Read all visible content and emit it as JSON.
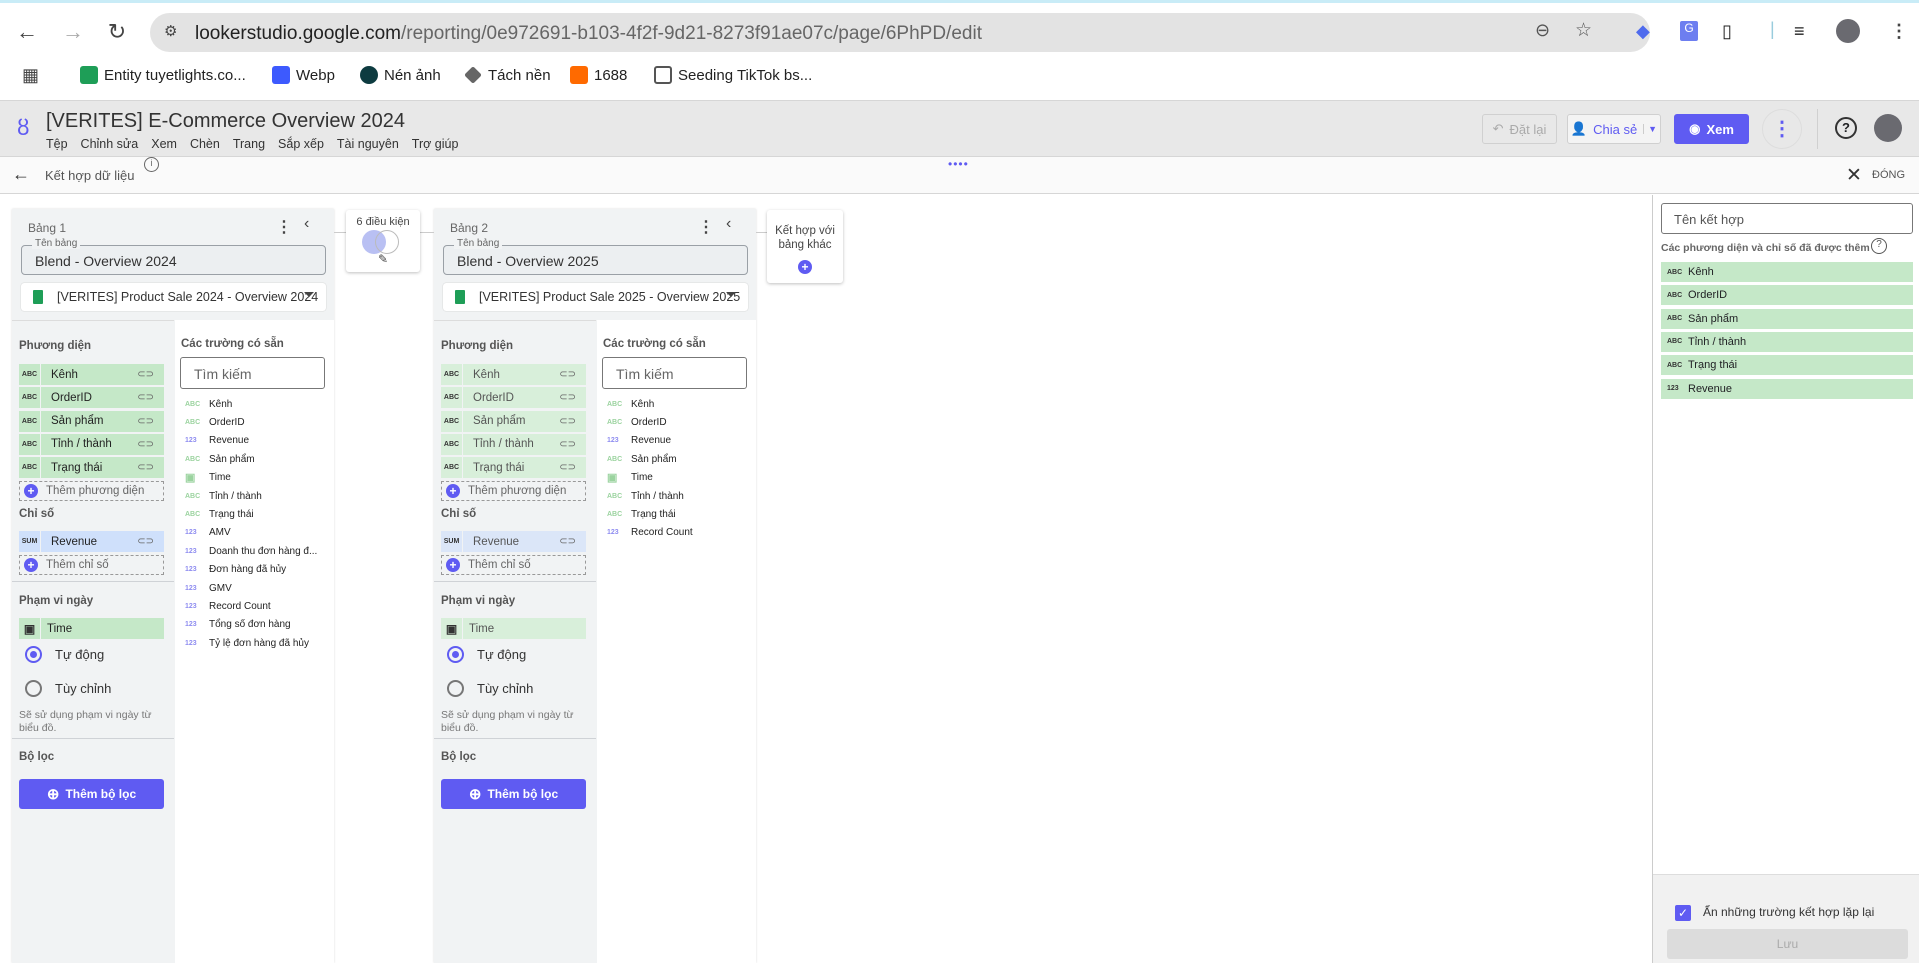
{
  "browser": {
    "url_host": "lookerstudio.google.com",
    "url_path": "/reporting/0e972691-b103-4f2f-9d21-8273f91ae07c/page/6PhPD/edit",
    "bookmarks": [
      {
        "label": "Entity tuyetlights.co...",
        "icon": "sheets-plus-icon",
        "color": "#1e9e57"
      },
      {
        "label": "Webp",
        "icon": "power-icon",
        "color": "#3d5afe"
      },
      {
        "label": "Nén ảnh",
        "icon": "dot-icon",
        "color": "#0d3b40"
      },
      {
        "label": "Tách nền",
        "icon": "layers-icon",
        "color": "#555555"
      },
      {
        "label": "1688",
        "icon": "1688-icon",
        "color": "#ff6a00"
      },
      {
        "label": "Seeding TikTok bs...",
        "icon": "folder-icon",
        "color": "#555555"
      }
    ]
  },
  "app": {
    "title": "[VERITES] E-Commerce Overview 2024",
    "menu": [
      "Tệp",
      "Chỉnh sửa",
      "Xem",
      "Chèn",
      "Trang",
      "Sắp xếp",
      "Tài nguyên",
      "Trợ giúp"
    ],
    "reset_label": "Đặt lại",
    "share_label": "Chia sẻ",
    "view_label": "Xem",
    "accent": "#5f5bf2"
  },
  "subheader": {
    "title": "Kết hợp dữ liệu",
    "close_label": "ĐÓNG"
  },
  "tables": [
    {
      "title": "Bảng 1",
      "name_label": "Tên bảng",
      "name": "Blend - Overview 2024",
      "source": "[VERITES] Product Sale 2024 - Overview 2024",
      "dimensions_label": "Phương diện",
      "dimensions": [
        {
          "type": "ABC",
          "name": "Kênh"
        },
        {
          "type": "ABC",
          "name": "OrderID"
        },
        {
          "type": "ABC",
          "name": "Sản phẩm"
        },
        {
          "type": "ABC",
          "name": "Tỉnh / thành"
        },
        {
          "type": "ABC",
          "name": "Trạng thái"
        }
      ],
      "add_dimension": "Thêm phương diện",
      "metrics_label": "Chỉ số",
      "metrics": [
        {
          "type": "SUM",
          "name": "Revenue"
        }
      ],
      "add_metric": "Thêm chỉ số",
      "date_range_label": "Phạm vi ngày",
      "date_field": "Time",
      "auto_label": "Tự động",
      "custom_label": "Tùy chỉnh",
      "date_note": "Sẽ sử dụng phạm vi ngày từ biểu đồ.",
      "filter_label": "Bộ lọc",
      "add_filter": "Thêm bộ lọc",
      "available_label": "Các trường có sẵn",
      "search_placeholder": "Tìm kiếm",
      "available": [
        {
          "type": "ABC",
          "name": "Kênh"
        },
        {
          "type": "ABC",
          "name": "OrderID"
        },
        {
          "type": "123",
          "name": "Revenue"
        },
        {
          "type": "ABC",
          "name": "Sản phẩm"
        },
        {
          "type": "date",
          "name": "Time"
        },
        {
          "type": "ABC",
          "name": "Tỉnh / thành"
        },
        {
          "type": "ABC",
          "name": "Trạng thái"
        },
        {
          "type": "123",
          "name": "AMV"
        },
        {
          "type": "123",
          "name": "Doanh thu đơn hàng đ..."
        },
        {
          "type": "123",
          "name": "Đơn hàng đã hủy"
        },
        {
          "type": "123",
          "name": "GMV"
        },
        {
          "type": "123",
          "name": "Record Count"
        },
        {
          "type": "123",
          "name": "Tổng số đơn hàng"
        },
        {
          "type": "123",
          "name": "Tỷ lệ đơn hàng đã hủy"
        }
      ]
    },
    {
      "title": "Bảng 2",
      "name_label": "Tên bảng",
      "name": "Blend - Overview 2025",
      "source": "[VERITES] Product Sale 2025 - Overview 2025",
      "dimensions_label": "Phương diện",
      "dimensions": [
        {
          "type": "ABC",
          "name": "Kênh"
        },
        {
          "type": "ABC",
          "name": "OrderID"
        },
        {
          "type": "ABC",
          "name": "Sản phẩm"
        },
        {
          "type": "ABC",
          "name": "Tỉnh / thành"
        },
        {
          "type": "ABC",
          "name": "Trạng thái"
        }
      ],
      "add_dimension": "Thêm phương diện",
      "metrics_label": "Chỉ số",
      "metrics": [
        {
          "type": "SUM",
          "name": "Revenue"
        }
      ],
      "add_metric": "Thêm chỉ số",
      "date_range_label": "Phạm vi ngày",
      "date_field": "Time",
      "auto_label": "Tự động",
      "custom_label": "Tùy chỉnh",
      "date_note": "Sẽ sử dụng phạm vi ngày từ biểu đồ.",
      "filter_label": "Bộ lọc",
      "add_filter": "Thêm bộ lọc",
      "available_label": "Các trường có sẵn",
      "search_placeholder": "Tìm kiếm",
      "available": [
        {
          "type": "ABC",
          "name": "Kênh"
        },
        {
          "type": "ABC",
          "name": "OrderID"
        },
        {
          "type": "123",
          "name": "Revenue"
        },
        {
          "type": "ABC",
          "name": "Sản phẩm"
        },
        {
          "type": "date",
          "name": "Time"
        },
        {
          "type": "ABC",
          "name": "Tỉnh / thành"
        },
        {
          "type": "ABC",
          "name": "Trạng thái"
        },
        {
          "type": "123",
          "name": "Record Count"
        }
      ]
    }
  ],
  "join": {
    "conditions_label": "6 điều kiện"
  },
  "add_table": {
    "label": "Kết hợp với bảng khác"
  },
  "blend_panel": {
    "name_placeholder": "Tên kết hợp",
    "added_label": "Các phương diện và chỉ số đã được thêm",
    "fields": [
      {
        "type": "ABC",
        "name": "Kênh"
      },
      {
        "type": "ABC",
        "name": "OrderID"
      },
      {
        "type": "ABC",
        "name": "Sản phẩm"
      },
      {
        "type": "ABC",
        "name": "Tỉnh / thành"
      },
      {
        "type": "ABC",
        "name": "Trạng thái"
      },
      {
        "type": "123",
        "name": "Revenue"
      }
    ],
    "hide_repeated_label": "Ẩn những trường kết hợp lặp lại",
    "hide_repeated_checked": true,
    "save_label": "Lưu"
  }
}
